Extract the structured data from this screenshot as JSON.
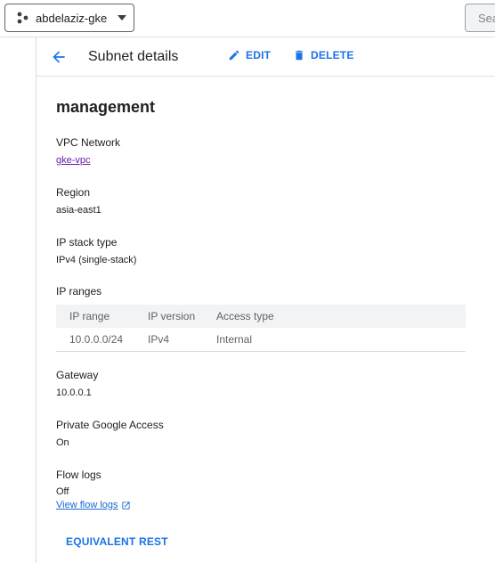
{
  "topbar": {
    "project_name": "abdelaziz-gke",
    "search_placeholder": "Sea"
  },
  "header": {
    "title": "Subnet details",
    "edit_label": "EDIT",
    "delete_label": "DELETE"
  },
  "subnet": {
    "name": "management",
    "vpc_network_label": "VPC Network",
    "vpc_network_value": "gke-vpc",
    "region_label": "Region",
    "region_value": "asia-east1",
    "ip_stack_label": "IP stack type",
    "ip_stack_value": "IPv4 (single-stack)",
    "ip_ranges_label": "IP ranges",
    "ip_table": {
      "headers": [
        "IP range",
        "IP version",
        "Access type"
      ],
      "rows": [
        [
          "10.0.0.0/24",
          "IPv4",
          "Internal"
        ]
      ]
    },
    "gateway_label": "Gateway",
    "gateway_value": "10.0.0.1",
    "private_access_label": "Private Google Access",
    "private_access_value": "On",
    "flow_logs_label": "Flow logs",
    "flow_logs_value": "Off",
    "flow_logs_link": "View flow logs"
  },
  "footer": {
    "rest_label": "EQUIVALENT REST"
  },
  "colors": {
    "accent": "#1a73e8",
    "visited_link": "#681da8"
  },
  "icons": {
    "back": "arrow-back-icon",
    "edit": "pencil-icon",
    "delete": "trash-icon",
    "project": "project-nodes-icon",
    "external": "open-in-new-icon"
  }
}
